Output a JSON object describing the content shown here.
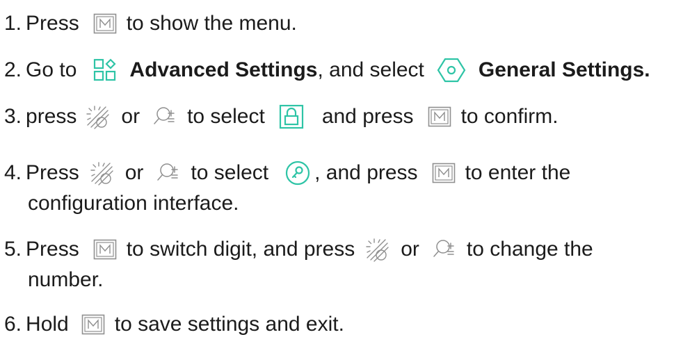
{
  "steps": [
    {
      "num": "1.",
      "p1": "Press",
      "p2": "to show the menu."
    },
    {
      "num": "2.",
      "p1": "Go to",
      "p2": "Advanced Settings",
      "p3": ", and select",
      "p4": "General Settings."
    },
    {
      "num": "3.",
      "p1": "press",
      "p2": "or",
      "p3": "to select",
      "p4": "and press",
      "p5": "to confirm."
    },
    {
      "num": "4.",
      "p1": "Press",
      "p2": "or",
      "p3": "to select",
      "p4": ", and press",
      "p5": "to enter the",
      "p6": "configuration interface."
    },
    {
      "num": "5.",
      "p1": "Press",
      "p2": "to switch digit, and press",
      "p3": "or",
      "p4": "to change the",
      "p5": "number."
    },
    {
      "num": "6.",
      "p1": "Hold",
      "p2": "to save settings and exit."
    }
  ],
  "icons": {
    "menu_button": "m-button-icon",
    "advanced_settings": "advanced-settings-icon",
    "general_settings": "general-settings-icon",
    "brightness": "brightness-icon",
    "zoom": "zoom-icon",
    "lock": "lock-icon",
    "password": "key-icon"
  },
  "colors": {
    "accent": "#2ec4a6",
    "text": "#1b1b1b",
    "button_gray": "#8f8f8f"
  }
}
